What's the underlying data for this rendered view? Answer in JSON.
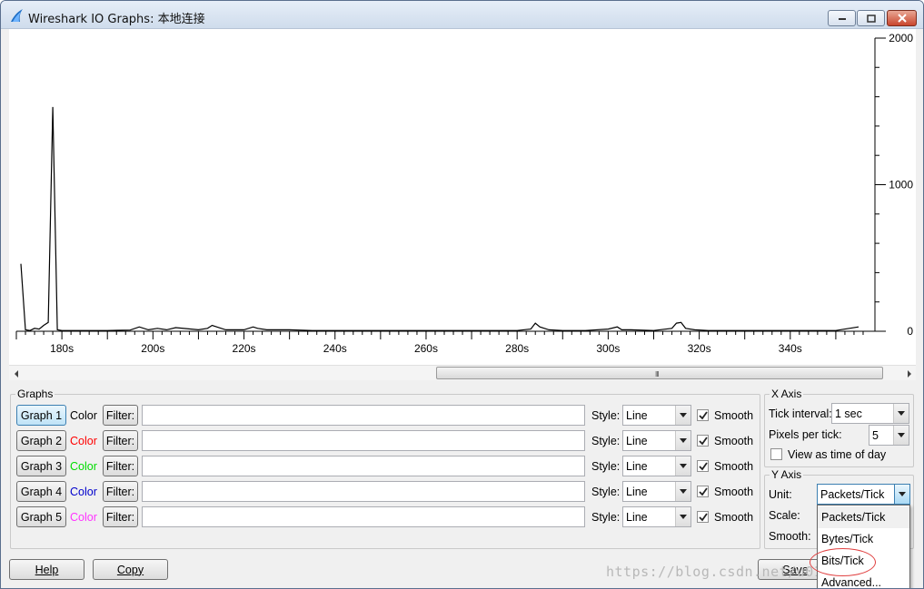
{
  "window": {
    "title": "Wireshark IO Graphs: 本地连接"
  },
  "chart_data": {
    "type": "line",
    "x_unit_suffix": "s",
    "xlim": [
      170,
      358
    ],
    "ylim": [
      0,
      2000
    ],
    "x_ticks": [
      180,
      200,
      220,
      240,
      260,
      280,
      300,
      320,
      340
    ],
    "x_tick_labels": [
      "180s",
      "200s",
      "220s",
      "240s",
      "260s",
      "280s",
      "300s",
      "320s",
      "340s"
    ],
    "y_ticks": [
      0,
      1000,
      2000
    ],
    "y_tick_labels": [
      "0",
      "1000",
      "2000"
    ],
    "y_axis_position": "right",
    "series": [
      {
        "color": "#000000",
        "x": [
          171,
          172,
          173,
          174,
          175,
          176,
          177,
          178,
          179,
          180,
          185,
          190,
          195,
          197,
          199,
          201,
          203,
          205,
          210,
          212,
          213,
          214,
          216,
          220,
          222,
          223,
          225,
          230,
          235,
          240,
          250,
          260,
          270,
          280,
          283,
          284,
          285,
          287,
          290,
          295,
          300,
          302,
          303,
          305,
          310,
          314,
          315,
          316,
          317,
          319,
          322,
          330,
          340,
          350,
          355
        ],
        "y": [
          460,
          10,
          5,
          20,
          15,
          40,
          60,
          1530,
          10,
          5,
          5,
          5,
          8,
          30,
          10,
          20,
          10,
          25,
          10,
          20,
          40,
          30,
          10,
          10,
          30,
          20,
          10,
          10,
          5,
          5,
          5,
          5,
          5,
          5,
          15,
          55,
          30,
          10,
          5,
          5,
          15,
          30,
          10,
          10,
          5,
          20,
          55,
          60,
          20,
          10,
          5,
          5,
          5,
          5,
          30
        ]
      }
    ]
  },
  "scrollbar": {
    "grip": "III"
  },
  "graphs": {
    "title": "Graphs",
    "color_label": "Color",
    "filter_label": "Filter:",
    "style_label": "Style:",
    "smooth_label": "Smooth",
    "rows": [
      {
        "name": "Graph 1",
        "color": "#000000",
        "style": "Line",
        "filter": "",
        "smooth": true,
        "active": true
      },
      {
        "name": "Graph 2",
        "color": "#ff0000",
        "style": "Line",
        "filter": "",
        "smooth": true,
        "active": false
      },
      {
        "name": "Graph 3",
        "color": "#00dd00",
        "style": "Line",
        "filter": "",
        "smooth": true,
        "active": false
      },
      {
        "name": "Graph 4",
        "color": "#0000cc",
        "style": "Line",
        "filter": "",
        "smooth": true,
        "active": false
      },
      {
        "name": "Graph 5",
        "color": "#ff33ff",
        "style": "Line",
        "filter": "",
        "smooth": true,
        "active": false
      }
    ]
  },
  "x_axis": {
    "title": "X Axis",
    "tick_interval_label": "Tick interval:",
    "tick_interval_value": "1 sec",
    "pixels_per_tick_label": "Pixels per tick:",
    "pixels_per_tick_value": "5",
    "view_time_label": "View as time of day",
    "view_time_checked": false
  },
  "y_axis": {
    "title": "Y Axis",
    "unit_label": "Unit:",
    "unit_value": "Packets/Tick",
    "scale_label": "Scale:",
    "smooth_label": "Smooth:",
    "unit_options": [
      "Packets/Tick",
      "Bytes/Tick",
      "Bits/Tick",
      "Advanced..."
    ]
  },
  "buttons": {
    "help": "Help",
    "copy": "Copy",
    "save": "Save"
  },
  "watermark": "https://blog.csdn.net/u012wuyulhub"
}
